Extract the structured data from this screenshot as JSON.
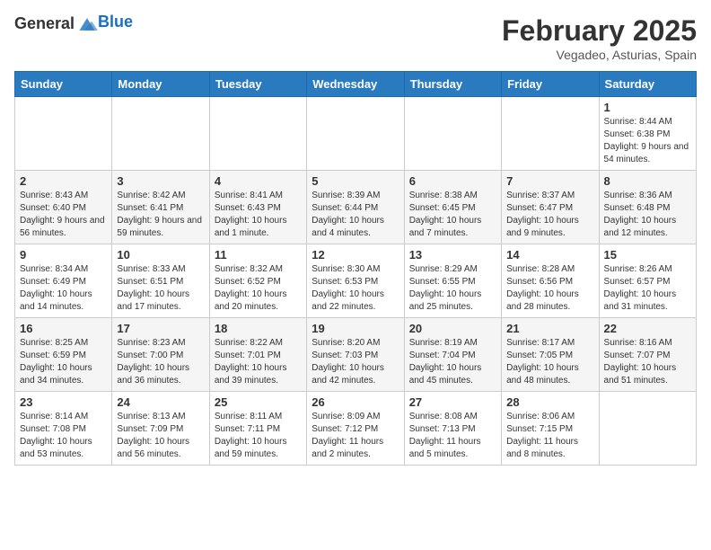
{
  "logo": {
    "text_general": "General",
    "text_blue": "Blue"
  },
  "title": "February 2025",
  "subtitle": "Vegadeo, Asturias, Spain",
  "days_of_week": [
    "Sunday",
    "Monday",
    "Tuesday",
    "Wednesday",
    "Thursday",
    "Friday",
    "Saturday"
  ],
  "weeks": [
    [
      {
        "day": "",
        "info": ""
      },
      {
        "day": "",
        "info": ""
      },
      {
        "day": "",
        "info": ""
      },
      {
        "day": "",
        "info": ""
      },
      {
        "day": "",
        "info": ""
      },
      {
        "day": "",
        "info": ""
      },
      {
        "day": "1",
        "info": "Sunrise: 8:44 AM\nSunset: 6:38 PM\nDaylight: 9 hours and 54 minutes."
      }
    ],
    [
      {
        "day": "2",
        "info": "Sunrise: 8:43 AM\nSunset: 6:40 PM\nDaylight: 9 hours and 56 minutes."
      },
      {
        "day": "3",
        "info": "Sunrise: 8:42 AM\nSunset: 6:41 PM\nDaylight: 9 hours and 59 minutes."
      },
      {
        "day": "4",
        "info": "Sunrise: 8:41 AM\nSunset: 6:43 PM\nDaylight: 10 hours and 1 minute."
      },
      {
        "day": "5",
        "info": "Sunrise: 8:39 AM\nSunset: 6:44 PM\nDaylight: 10 hours and 4 minutes."
      },
      {
        "day": "6",
        "info": "Sunrise: 8:38 AM\nSunset: 6:45 PM\nDaylight: 10 hours and 7 minutes."
      },
      {
        "day": "7",
        "info": "Sunrise: 8:37 AM\nSunset: 6:47 PM\nDaylight: 10 hours and 9 minutes."
      },
      {
        "day": "8",
        "info": "Sunrise: 8:36 AM\nSunset: 6:48 PM\nDaylight: 10 hours and 12 minutes."
      }
    ],
    [
      {
        "day": "9",
        "info": "Sunrise: 8:34 AM\nSunset: 6:49 PM\nDaylight: 10 hours and 14 minutes."
      },
      {
        "day": "10",
        "info": "Sunrise: 8:33 AM\nSunset: 6:51 PM\nDaylight: 10 hours and 17 minutes."
      },
      {
        "day": "11",
        "info": "Sunrise: 8:32 AM\nSunset: 6:52 PM\nDaylight: 10 hours and 20 minutes."
      },
      {
        "day": "12",
        "info": "Sunrise: 8:30 AM\nSunset: 6:53 PM\nDaylight: 10 hours and 22 minutes."
      },
      {
        "day": "13",
        "info": "Sunrise: 8:29 AM\nSunset: 6:55 PM\nDaylight: 10 hours and 25 minutes."
      },
      {
        "day": "14",
        "info": "Sunrise: 8:28 AM\nSunset: 6:56 PM\nDaylight: 10 hours and 28 minutes."
      },
      {
        "day": "15",
        "info": "Sunrise: 8:26 AM\nSunset: 6:57 PM\nDaylight: 10 hours and 31 minutes."
      }
    ],
    [
      {
        "day": "16",
        "info": "Sunrise: 8:25 AM\nSunset: 6:59 PM\nDaylight: 10 hours and 34 minutes."
      },
      {
        "day": "17",
        "info": "Sunrise: 8:23 AM\nSunset: 7:00 PM\nDaylight: 10 hours and 36 minutes."
      },
      {
        "day": "18",
        "info": "Sunrise: 8:22 AM\nSunset: 7:01 PM\nDaylight: 10 hours and 39 minutes."
      },
      {
        "day": "19",
        "info": "Sunrise: 8:20 AM\nSunset: 7:03 PM\nDaylight: 10 hours and 42 minutes."
      },
      {
        "day": "20",
        "info": "Sunrise: 8:19 AM\nSunset: 7:04 PM\nDaylight: 10 hours and 45 minutes."
      },
      {
        "day": "21",
        "info": "Sunrise: 8:17 AM\nSunset: 7:05 PM\nDaylight: 10 hours and 48 minutes."
      },
      {
        "day": "22",
        "info": "Sunrise: 8:16 AM\nSunset: 7:07 PM\nDaylight: 10 hours and 51 minutes."
      }
    ],
    [
      {
        "day": "23",
        "info": "Sunrise: 8:14 AM\nSunset: 7:08 PM\nDaylight: 10 hours and 53 minutes."
      },
      {
        "day": "24",
        "info": "Sunrise: 8:13 AM\nSunset: 7:09 PM\nDaylight: 10 hours and 56 minutes."
      },
      {
        "day": "25",
        "info": "Sunrise: 8:11 AM\nSunset: 7:11 PM\nDaylight: 10 hours and 59 minutes."
      },
      {
        "day": "26",
        "info": "Sunrise: 8:09 AM\nSunset: 7:12 PM\nDaylight: 11 hours and 2 minutes."
      },
      {
        "day": "27",
        "info": "Sunrise: 8:08 AM\nSunset: 7:13 PM\nDaylight: 11 hours and 5 minutes."
      },
      {
        "day": "28",
        "info": "Sunrise: 8:06 AM\nSunset: 7:15 PM\nDaylight: 11 hours and 8 minutes."
      },
      {
        "day": "",
        "info": ""
      }
    ]
  ]
}
